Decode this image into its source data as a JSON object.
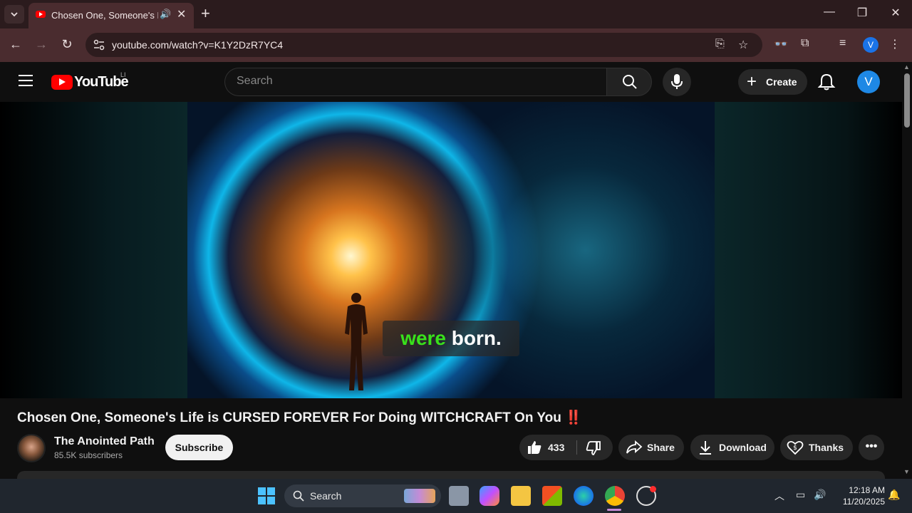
{
  "browser": {
    "tab_title": "Chosen One, Someone's Life is CURSED FOREVER For Doing WITCHCRAFT On You",
    "url": "youtube.com/watch?v=K1Y2DzR7YC4",
    "profile_initial": "V"
  },
  "youtube": {
    "wordmark": "YouTube",
    "country_code": "LI",
    "search_placeholder": "Search",
    "create_label": "Create",
    "avatar_initial": "V"
  },
  "video": {
    "caption_word_1": "were",
    "caption_word_2": "born.",
    "title": "Chosen One, Someone's Life is CURSED FOREVER For Doing WITCHCRAFT On You",
    "title_emoji": "‼️",
    "channel_name": "The Anointed Path",
    "subscribers": "85.5K subscribers",
    "subscribe_label": "Subscribe",
    "likes": "433",
    "share_label": "Share",
    "download_label": "Download",
    "thanks_label": "Thanks"
  },
  "taskbar": {
    "search_label": "Search",
    "time": "12:18 AM",
    "date": "11/20/2025"
  },
  "colors": {
    "youtube_red": "#ff0000",
    "caption_green": "#39e11b",
    "browser_frame": "#4a2c2f",
    "page_background": "#0f0f0f"
  }
}
